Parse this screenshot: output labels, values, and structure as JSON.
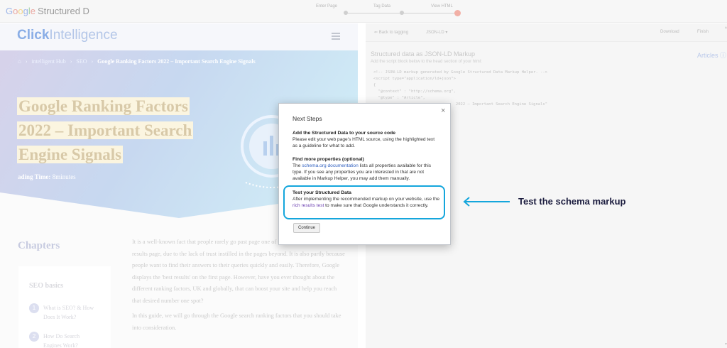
{
  "header": {
    "brand_google": [
      "G",
      "o",
      "o",
      "g",
      "l",
      "e"
    ],
    "brand_rest": "Structured D",
    "steps": [
      "Enter Page",
      "Tag Data",
      "View HTML"
    ],
    "active_step": 3
  },
  "site": {
    "logo_bold": "Click",
    "logo_rest": "Intelligence",
    "breadcrumbs": [
      "intelligent Hub",
      "SEO",
      "Google Ranking Factors 2022 – Important Search Engine Signals"
    ],
    "title_lines": [
      "Google Ranking Factors",
      "2022 – Important Search",
      "Engine Signals"
    ],
    "reading_label": "ading Time:",
    "reading_value": "8minutes",
    "chapters_title": "Chapters",
    "toc_head": "SEO basics",
    "toc_items": [
      {
        "num": "1",
        "line1": "What is SEO? & How",
        "line2": "Does It Work?"
      },
      {
        "num": "2",
        "line1": "How Do Search",
        "line2": "Engines Work?"
      }
    ],
    "paragraph1": "It is a well-known fact that people rarely go past page one of the Google search engine results page, due to the lack of trust instilled in the pages beyond. It is also partly because people want to find their answers to their queries quickly and easily. Therefore, Google displays the 'best results' on the first page. However, have you ever thought about the different ranking factors, UK and globally, that can boost your site and help you reach that desired number one spot?",
    "paragraph2": "In this guide, we will go through the Google search ranking factors that you should take into consideration."
  },
  "panel": {
    "back_label": "Back to tagging",
    "format_label": "JSON-LD",
    "download_label": "Download",
    "finish_label": "Finish",
    "title": "Structured data as JSON-LD Markup",
    "subtitle": "Add the script block below to the head section of your html:",
    "articles_label": "Articles",
    "code_lines": [
      "<!-- JSON-LD markup generated by Google Structured Data Markup Helper. -->",
      "<script type=\"application/ld+json\">",
      "{",
      "  \"@context\" : \"http://schema.org\",",
      "  \"@type\" : \"Article\",",
      "                                   2022 – Important Search Engine Signals\""
    ]
  },
  "modal": {
    "title": "Next Steps",
    "close_glyph": "×",
    "sections": [
      {
        "heading": "Add the Structured Data to your source code",
        "body": "Please edit your web page's HTML source, using the highlighted text as a guideline for what to add."
      },
      {
        "heading": "Find more properties (optional)",
        "link": "schema.org documentation",
        "body": " lists all properties available for this type. If you see any properties you are interested in that are not available in Markup Helper, you may add them manually."
      },
      {
        "heading": "Test your Structured Data",
        "body_before": "After implementing the recommended markup on your website, use the ",
        "link": "rich results test",
        "body_after": " to make sure that Google understands it correctly."
      }
    ],
    "continue_label": "Continue"
  },
  "annotation": {
    "text": "Test the schema markup",
    "color": "#14a6dc"
  }
}
